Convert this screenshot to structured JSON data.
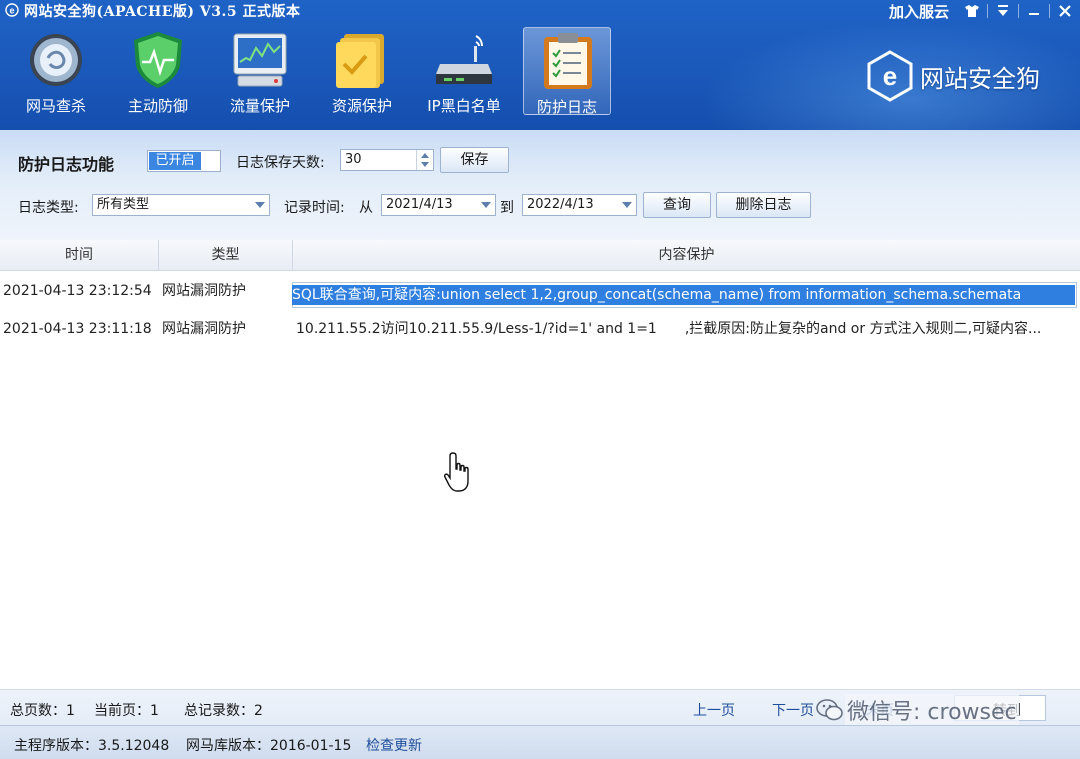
{
  "window": {
    "title": "网站安全狗(APACHE版) V3.5 正式版本",
    "join_cloud": "加入服云",
    "controls": [
      "shirt-icon",
      "menu-icon",
      "minimize-icon",
      "close-icon"
    ]
  },
  "toolbar": {
    "items": [
      {
        "label": "网马查杀",
        "icon": "scan-globe-icon"
      },
      {
        "label": "主动防御",
        "icon": "shield-icon"
      },
      {
        "label": "流量保护",
        "icon": "traffic-monitor-icon"
      },
      {
        "label": "资源保护",
        "icon": "folder-check-icon"
      },
      {
        "label": "IP黑白名单",
        "icon": "router-icon"
      },
      {
        "label": "防护日志",
        "icon": "clipboard-icon",
        "active": true
      }
    ],
    "brand": "网站安全狗"
  },
  "settings": {
    "feature_label": "防护日志功能",
    "toggle_state": "已开启",
    "days_label": "日志保存天数:",
    "days_value": "30",
    "save_button": "保存"
  },
  "filter": {
    "type_label": "日志类型:",
    "type_value": "所有类型",
    "time_label": "记录时间:",
    "from_label": "从",
    "from_date": "2021/4/13",
    "to_label": "到",
    "to_date": "2022/4/13",
    "query_button": "查询",
    "delete_button": "删除日志"
  },
  "table": {
    "columns": [
      "时间",
      "类型",
      "内容保护"
    ],
    "rows": [
      {
        "time": "2021-04-13 23:12:54",
        "type": "网站漏洞防护",
        "content": "SQL联合查询,可疑内容:union select 1,2,group_concat(schema_name) from information_schema.schemata",
        "selected": true
      },
      {
        "time": "2021-04-13 23:11:18",
        "type": "网站漏洞防护",
        "content": "10.211.55.2访问10.211.55.9/Less-1/?id=1' and 1=1　　,拦截原因:防止复杂的and or 方式注入规则二,可疑内容...",
        "selected": false
      }
    ]
  },
  "pager": {
    "total_pages": "总页数：1",
    "current_page": "当前页：1",
    "total_records": "总记录数：2",
    "prev": "上一页",
    "next": "下一页",
    "last": "末页",
    "go": "转到"
  },
  "status": {
    "main_version": "主程序版本：3.5.12048",
    "db_version": "网马库版本：2016-01-15",
    "check_update": "检查更新"
  },
  "watermark": "微信号: crowsec"
}
